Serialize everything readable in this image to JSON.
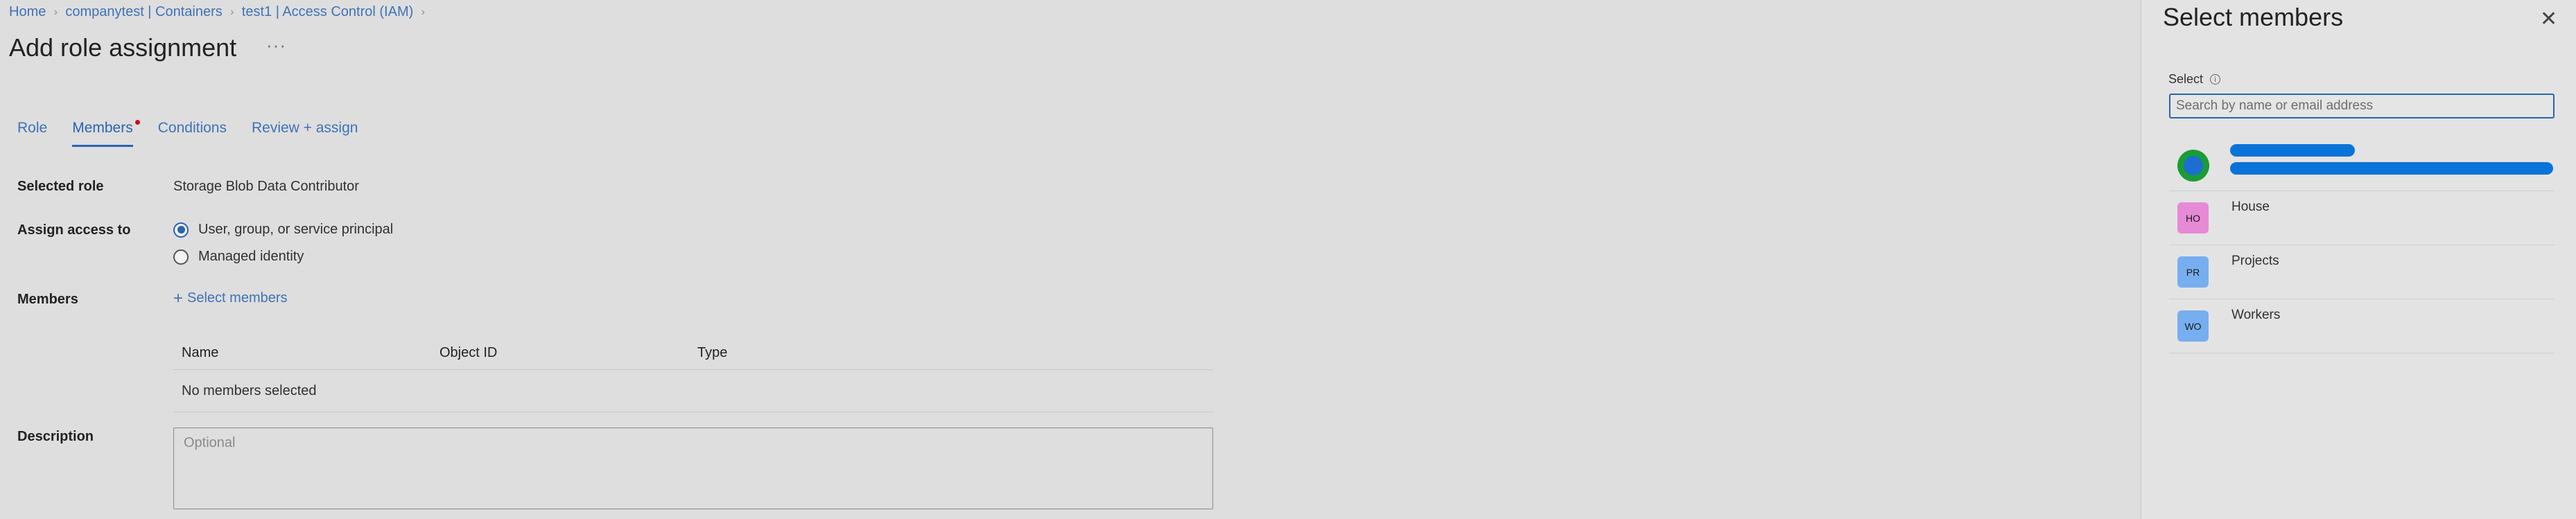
{
  "breadcrumb": [
    {
      "label": "Home"
    },
    {
      "label": "companytest | Containers"
    },
    {
      "label": "test1 | Access Control (IAM)"
    }
  ],
  "page": {
    "title": "Add role assignment",
    "more_label": "···"
  },
  "tabs": [
    {
      "label": "Role",
      "active": false
    },
    {
      "label": "Members",
      "active": true,
      "has_indicator": true
    },
    {
      "label": "Conditions",
      "active": false
    },
    {
      "label": "Review + assign",
      "active": false
    }
  ],
  "form": {
    "selected_role_label": "Selected role",
    "selected_role_value": "Storage Blob Data Contributor",
    "assign_access_label": "Assign access to",
    "assign_options": [
      {
        "label": "User, group, or service principal",
        "checked": true
      },
      {
        "label": "Managed identity",
        "checked": false
      }
    ],
    "members_label": "Members",
    "select_members_link": "Select members",
    "table": {
      "columns": [
        "Name",
        "Object ID",
        "Type"
      ],
      "empty_text": "No members selected"
    },
    "description_label": "Description",
    "description_placeholder": "Optional"
  },
  "panel": {
    "title": "Select members",
    "select_label": "Select",
    "search_placeholder": "Search by name or email address",
    "search_value": "",
    "results": [
      {
        "type": "user",
        "name": "",
        "redacted": true
      },
      {
        "type": "group",
        "initials": "HO",
        "name": "House",
        "avatar_color": "#e68ad6"
      },
      {
        "type": "group",
        "initials": "PR",
        "name": "Projects",
        "avatar_color": "#77aef0"
      },
      {
        "type": "group",
        "initials": "WO",
        "name": "Workers",
        "avatar_color": "#77aef0"
      }
    ]
  },
  "colors": {
    "accent": "#2a63b3",
    "link": "#3f72b8",
    "indicator": "#c50f1f",
    "background": "#dedede"
  }
}
